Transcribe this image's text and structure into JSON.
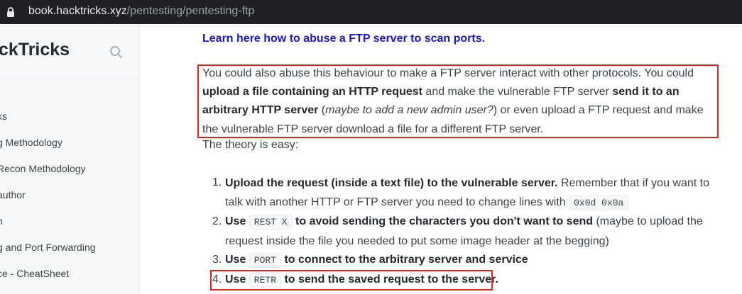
{
  "browser": {
    "url_host": "book.hacktricks.xyz",
    "url_path": "/pentesting/pentesting-ftp"
  },
  "sidebar": {
    "brand": "ckTricks",
    "items": [
      "ks",
      "g Methodology",
      "Recon Methodology",
      " author",
      "n",
      "g and Port Forwarding",
      "ce - CheatSheet"
    ]
  },
  "content": {
    "link": "Learn here how to abuse a FTP server to scan ports.",
    "para": {
      "t1": "You could also abuse this behaviour to make a FTP server interact with other protocols. You could ",
      "b1": "upload a file containing an HTTP request",
      "t2": " and make the vulnerable FTP server ",
      "b2": "send it to an arbitrary HTTP server",
      "t3": " (",
      "i1": "maybe to add a new admin user?",
      "t4": ") or even upload a FTP request and make the vulnerable FTP server download a file for a different FTP server."
    },
    "theory": "The theory is easy:",
    "steps": [
      {
        "num": "1.",
        "bold": "Upload the request (inside a text file) to the vulnerable server.",
        "text": " Remember that if you want to talk with another HTTP or FTP server you need to change lines with ",
        "code": "0x0d 0x0a"
      },
      {
        "num": "2.",
        "bold_pre": "Use ",
        "code": "REST X",
        "bold_post": " to avoid sending the characters you don't want to send",
        "text": " (maybe to upload the request inside the file you needed to put some image header at the begging)"
      },
      {
        "num": "3.",
        "bold_pre": "Use ",
        "code": "PORT",
        "bold_post": " to connect to the arbitrary server and service"
      },
      {
        "num": "4.",
        "bold_pre": "Use ",
        "code": "RETR",
        "bold_post": " to send the saved request to the server."
      }
    ]
  },
  "colors": {
    "link": "#1c15d1",
    "highlight_box": "#e2231a",
    "sidebar_bg": "#f5f7f9",
    "urlbar_bg": "#202124"
  },
  "icons": [
    "lock-icon",
    "search-icon"
  ]
}
